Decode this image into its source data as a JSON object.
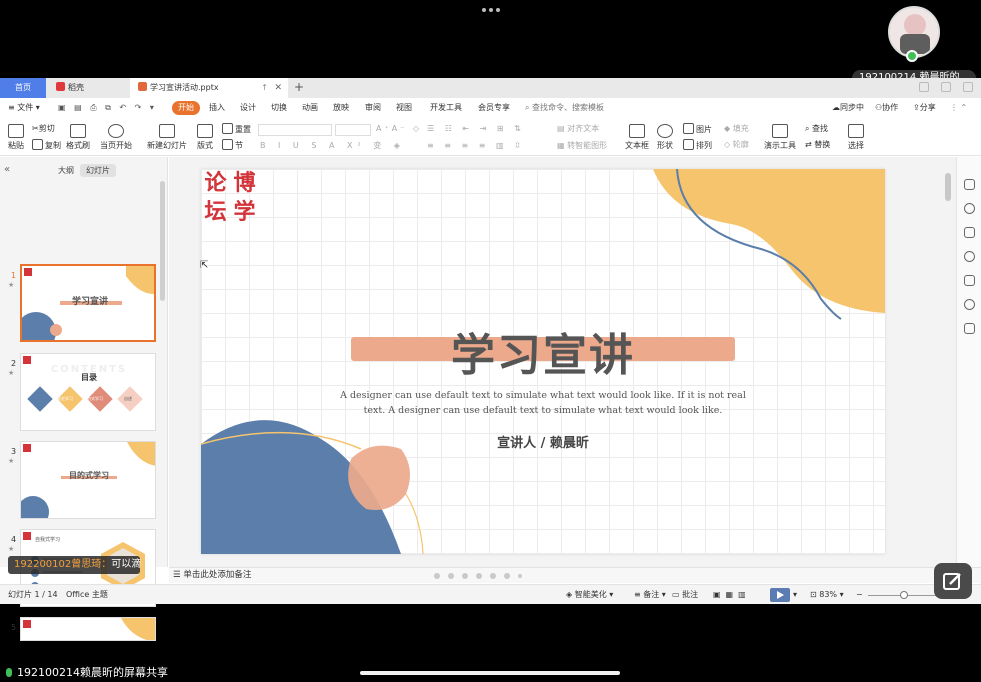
{
  "meeting": {
    "participant_name": "192100214 赖晨昕的...",
    "share_label": "192100214赖晨昕的屏幕共享",
    "chat_sender": "192200102曾思琦：",
    "chat_message": "可以滴"
  },
  "tabs": {
    "home": "首页",
    "doc1": "稻壳",
    "doc2": "学习宣讲活动.pptx",
    "add": "+"
  },
  "menubar": {
    "file": "≡ 文件 ▾",
    "items": [
      "开始",
      "插入",
      "设计",
      "切换",
      "动画",
      "放映",
      "审阅",
      "视图",
      "开发工具",
      "会员专享"
    ],
    "search": "查找命令、搜索模板",
    "sync": "同步中",
    "collab": "协作",
    "share": "分享"
  },
  "toolbar": {
    "paste": "粘贴",
    "cut": "剪切",
    "copy": "复制",
    "format_painter": "格式刷",
    "from_current": "当页开始",
    "new_slide": "新建幻灯片",
    "layout": "版式",
    "section": "节",
    "reset": "重置",
    "align_text": "对齐文本",
    "smart_graphic": "转智能图形",
    "textbox": "文本框",
    "shape": "形状",
    "picture": "图片",
    "arrange": "排列",
    "fill": "填充",
    "outline": "轮廓",
    "present_tools": "演示工具",
    "find": "查找",
    "replace": "替换",
    "select": "选择"
  },
  "panel": {
    "outline_tab": "大纲",
    "slides_tab": "幻灯片",
    "thumb_numbers": [
      "1",
      "2",
      "3",
      "4",
      "5"
    ],
    "thumb1_title": "学习宣讲",
    "thumb2_title": "目录",
    "thumb2_bg": "CONTENTS",
    "thumb2_items": [
      "",
      "先驱史学习",
      "目的式学习",
      "自述"
    ],
    "thumb3_title": "目的式学习",
    "thumb4_title": "自我式学习"
  },
  "slide": {
    "seal_chars": [
      "论",
      "博",
      "坛",
      "学"
    ],
    "title": "学习宣讲",
    "body": "A designer can use default text to simulate what text would look like. If it is not real text. A designer can use default text to simulate what text would look like.",
    "subtitle": "宣讲人 / 赖晨昕",
    "notes_placeholder": "单击此处添加备注"
  },
  "statusbar": {
    "slide_count": "幻灯片 1 / 14",
    "theme": "Office 主题",
    "beautify": "智能美化 ▾",
    "notes": "备注 ▾",
    "comment": "批注",
    "zoom": "83% ▾"
  },
  "colors": {
    "accent_orange": "#e9722d",
    "slide_yellow": "#f5c46d",
    "slide_blue": "#5b7faa",
    "slide_peach": "#eca98c",
    "seal_red": "#d2343a"
  }
}
